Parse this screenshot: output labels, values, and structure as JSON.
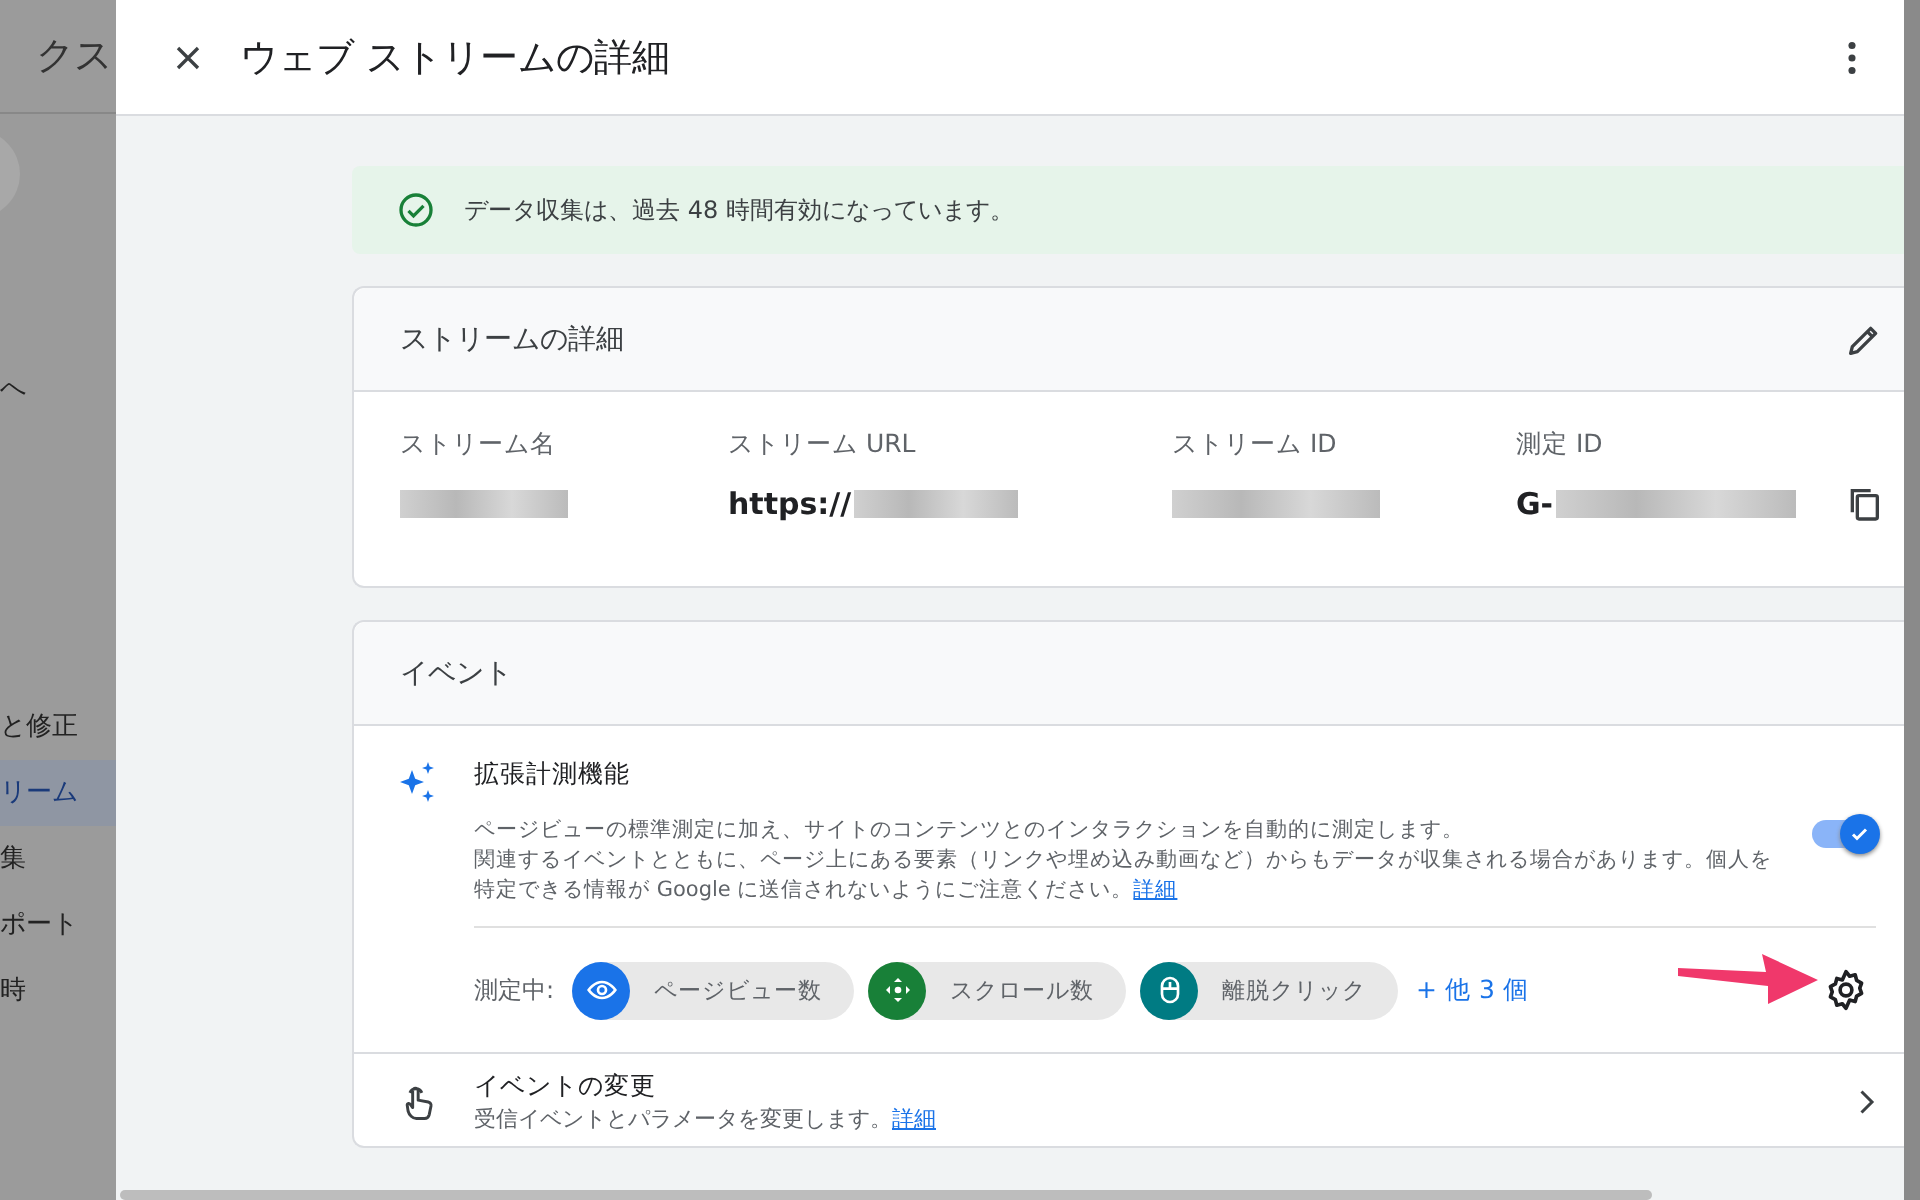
{
  "background_sidebar": {
    "title": "クス",
    "items": [
      {
        "label": "へ",
        "selected": false
      },
      {
        "label": "と修正",
        "selected": false
      },
      {
        "label": "リーム",
        "selected": true
      },
      {
        "label": "集",
        "selected": false
      },
      {
        "label": "ポート",
        "selected": false
      },
      {
        "label": "時",
        "selected": false
      }
    ]
  },
  "panel": {
    "title": "ウェブ ストリームの詳細",
    "banner": "データ収集は、過去 48 時間有効になっています。",
    "stream_details": {
      "title": "ストリームの詳細",
      "fields": [
        {
          "label": "ストリーム名",
          "copy": false
        },
        {
          "label": "ストリーム URL",
          "value": "https://",
          "copy": false
        },
        {
          "label": "ストリーム ID",
          "copy": false
        },
        {
          "label": "測定 ID",
          "value": "G-",
          "copy": true
        }
      ]
    },
    "events": {
      "title": "イベント",
      "enhanced": {
        "title": "拡張計測機能",
        "description": [
          "ページビューの標準測定に加え、サイトのコンテンツとのインタラクションを自動的に測定します。",
          "関連するイベントとともに、ページ上にある要素（リンクや埋め込み動画など）からもデータが収集される場合があります。個人を特定できる情報が Google に送信されないようにご注意ください。"
        ],
        "link": "詳細",
        "on": true,
        "measuring_label": "測定中:",
        "chips": [
          {
            "label": "ページビュー数",
            "kind": "eye",
            "color": "#1a73e8"
          },
          {
            "label": "スクロール数",
            "kind": "move",
            "color": "#188038"
          },
          {
            "label": "離脱クリック",
            "kind": "mouse",
            "color": "#007b83"
          }
        ],
        "more": "+ 他 3 個"
      },
      "modify": {
        "title": "イベントの変更",
        "description": "受信イベントとパラメータを変更します。",
        "link": "詳細"
      }
    }
  }
}
